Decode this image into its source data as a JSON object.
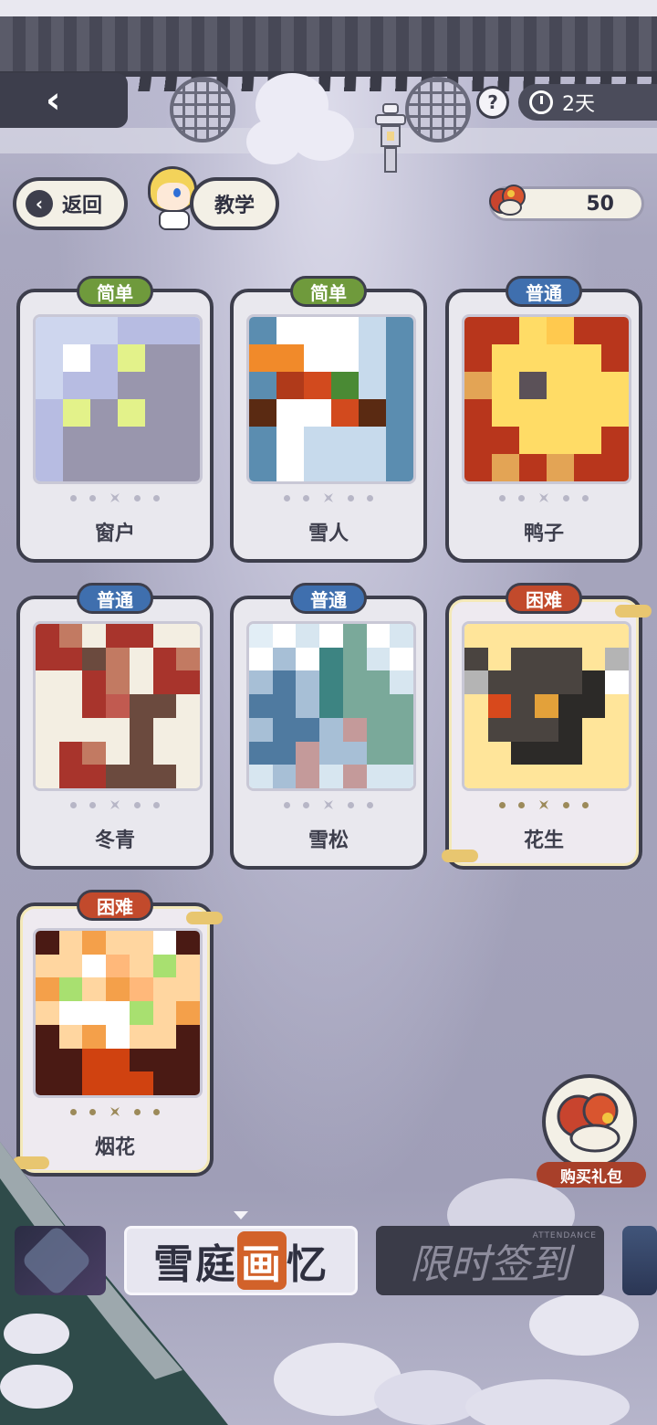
{
  "header": {
    "timer_label": "2天",
    "help_label": "?"
  },
  "nav": {
    "return_label": "返回",
    "tutorial_label": "教学",
    "currency_value": "50"
  },
  "puzzles": [
    {
      "name": "窗户",
      "difficulty": "简单",
      "tier": "easy"
    },
    {
      "name": "雪人",
      "difficulty": "简单",
      "tier": "easy"
    },
    {
      "name": "鸭子",
      "difficulty": "普通",
      "tier": "normal"
    },
    {
      "name": "冬青",
      "difficulty": "普通",
      "tier": "normal"
    },
    {
      "name": "雪松",
      "difficulty": "普通",
      "tier": "normal"
    },
    {
      "name": "花生",
      "difficulty": "困难",
      "tier": "hard"
    },
    {
      "name": "烟花",
      "difficulty": "困难",
      "tier": "hard"
    }
  ],
  "gift": {
    "label": "购买礼包"
  },
  "banners": {
    "main_title_a": "雪庭",
    "main_title_hl": "画",
    "main_title_b": "忆",
    "signin_title": "限时签到",
    "signin_sub": "ATTENDANCE"
  },
  "colors": {
    "easy": "#6f9a3c",
    "normal": "#3f6fae",
    "hard": "#c24a2c",
    "frame": "#3d3e4c"
  }
}
